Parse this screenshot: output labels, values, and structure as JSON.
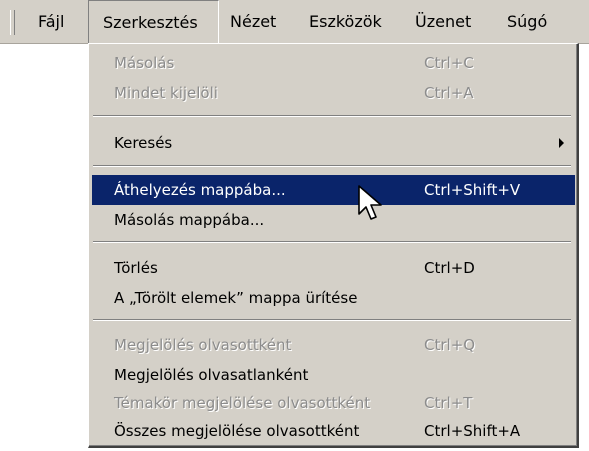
{
  "menubar": {
    "items": [
      "Fájl",
      "Szerkesztés",
      "Nézet",
      "Eszközök",
      "Üzenet",
      "Súgó"
    ],
    "active": "Szerkesztés"
  },
  "dropdown": {
    "copy": {
      "label": "Másolás",
      "shortcut": "Ctrl+C",
      "enabled": false
    },
    "select_all": {
      "label": "Mindet kijelöli",
      "shortcut": "Ctrl+A",
      "enabled": false
    },
    "find": {
      "label": "Keresés",
      "has_submenu": true,
      "enabled": true
    },
    "move_to_folder": {
      "label": "Áthelyezés mappába...",
      "shortcut": "Ctrl+Shift+V",
      "enabled": true,
      "highlighted": true
    },
    "copy_to_folder": {
      "label": "Másolás mappába...",
      "enabled": true
    },
    "delete": {
      "label": "Törlés",
      "shortcut": "Ctrl+D",
      "enabled": true
    },
    "empty_deleted": {
      "label": "A „Törölt elemek” mappa ürítése",
      "enabled": true
    },
    "mark_read": {
      "label": "Megjelölés olvasottként",
      "shortcut": "Ctrl+Q",
      "enabled": false
    },
    "mark_unread": {
      "label": "Megjelölés olvasatlanként",
      "enabled": true
    },
    "mark_thread_read": {
      "label": "Témakör megjelölése olvasottként",
      "shortcut": "Ctrl+T",
      "enabled": false
    },
    "mark_all_read": {
      "label": "Összes megjelölése olvasottként",
      "shortcut": "Ctrl+Shift+A",
      "enabled": true
    }
  },
  "colors": {
    "menu_background": "#d4d0c8",
    "highlight": "#0a246a",
    "highlight_text": "#ffffff",
    "disabled_text": "#8c8c8c"
  },
  "icons": {
    "submenu": "chevron-right-icon",
    "cursor": "mouse-pointer-icon"
  }
}
